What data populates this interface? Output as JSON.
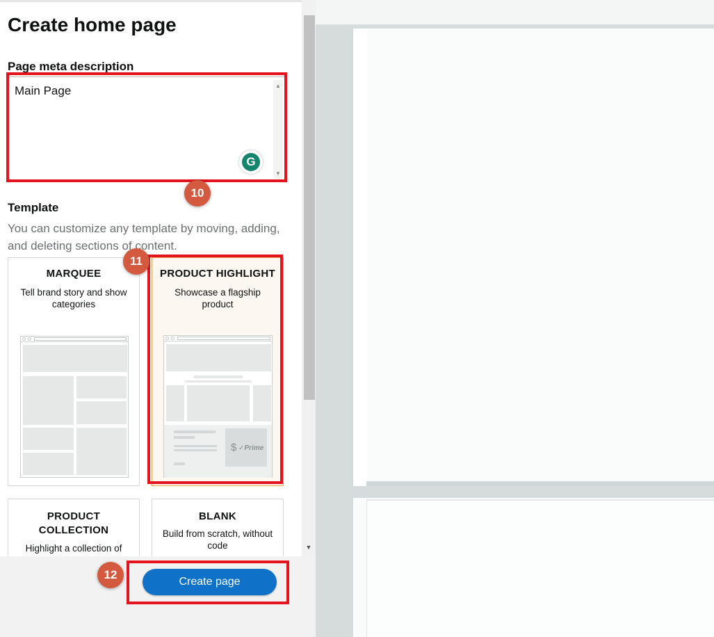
{
  "panel": {
    "title": "Create home page",
    "meta_label": "Page meta description",
    "meta_value": "Main Page",
    "template_label": "Template",
    "template_desc": "You can customize any template by moving, adding, and deleting sections of content."
  },
  "templates": [
    {
      "name": "MARQUEE",
      "desc": "Tell brand story and show categories"
    },
    {
      "name": "PRODUCT HIGHLIGHT",
      "desc": "Showcase a flagship product"
    },
    {
      "name": "PRODUCT COLLECTION",
      "desc": "Highlight a collection of related products"
    },
    {
      "name": "BLANK",
      "desc": "Build from scratch, without code"
    }
  ],
  "thumb": {
    "price_symbol": "$",
    "prime_label": "✓Prime"
  },
  "grammarly": {
    "glyph": "G"
  },
  "steps": [
    "10",
    "11",
    "12"
  ],
  "footer": {
    "create_label": "Create page"
  },
  "colors": {
    "highlight": "#e3141e",
    "step_badge": "#d35a3e",
    "primary_button": "#0f72c8",
    "grammarly": "#15846c"
  }
}
